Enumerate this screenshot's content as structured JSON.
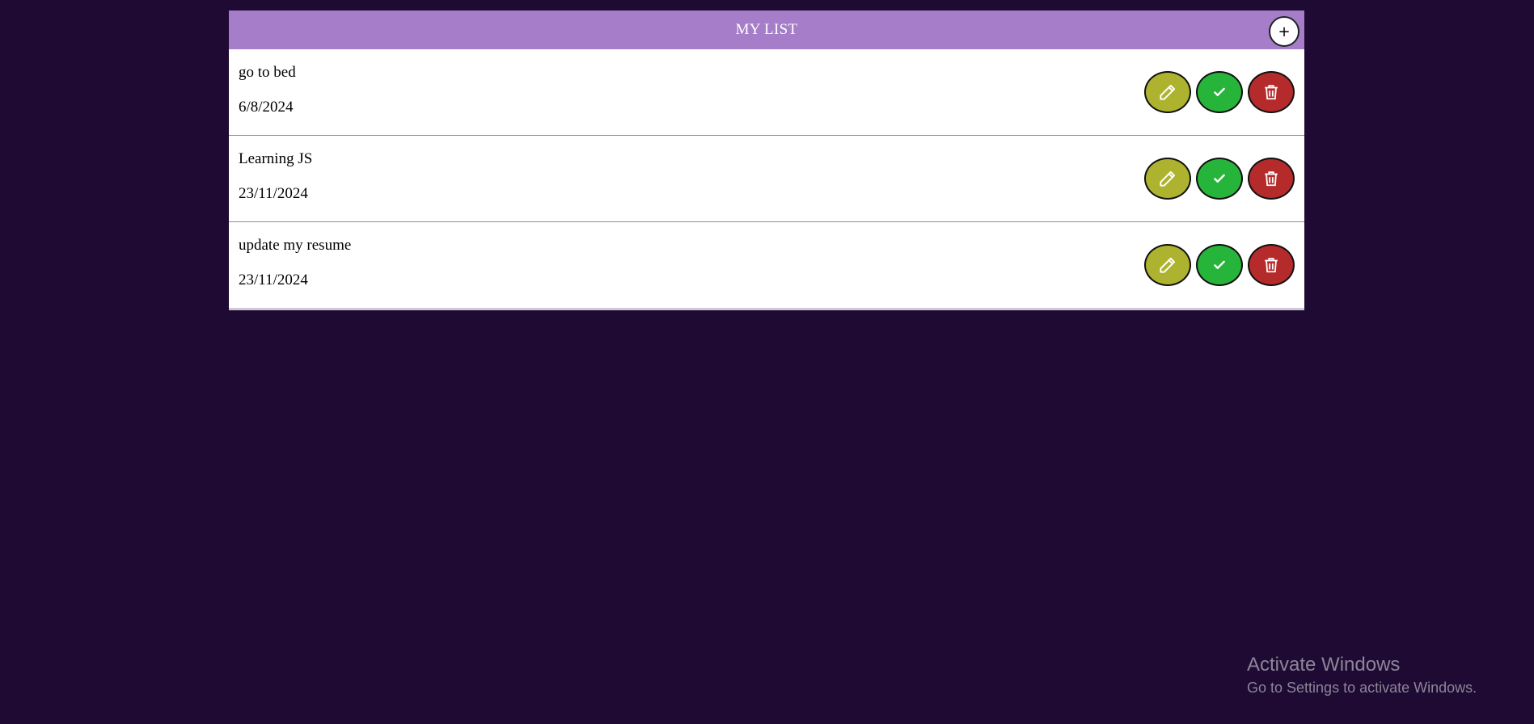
{
  "header": {
    "title": "MY LIST",
    "add_label": "+"
  },
  "todos": [
    {
      "title": "go to bed",
      "date": "6/8/2024"
    },
    {
      "title": "Learning JS",
      "date": "23/11/2024"
    },
    {
      "title": "update my resume",
      "date": "23/11/2024"
    }
  ],
  "icons": {
    "add": "plus-icon",
    "edit": "pencil-icon",
    "done": "check-icon",
    "delete": "trash-icon"
  },
  "colors": {
    "background": "#1f0a33",
    "header": "#a57dc8",
    "edit_button": "#adb32e",
    "done_button": "#27b43a",
    "delete_button": "#b52a2a"
  },
  "watermark": {
    "title": "Activate Windows",
    "subtitle": "Go to Settings to activate Windows."
  }
}
